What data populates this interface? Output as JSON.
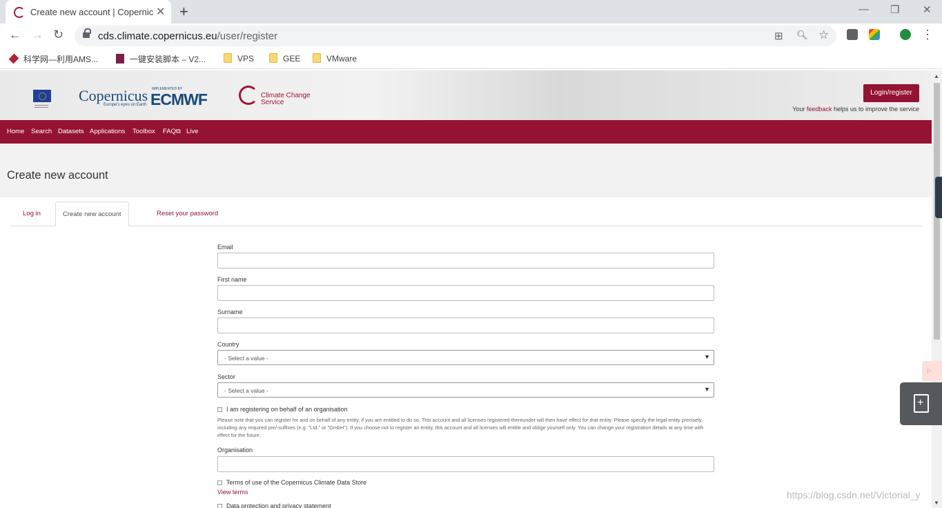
{
  "browser": {
    "tab_title": "Create new account | Copernic",
    "tab_close": "✕",
    "new_tab": "+",
    "url_host": "cds.climate.copernicus.eu",
    "url_path": "/user/register",
    "window_controls": {
      "minimize": "—",
      "restore": "❐",
      "close": "✕"
    },
    "nav": {
      "back": "←",
      "forward": "→",
      "reload": "↻",
      "menu": "⋮"
    },
    "omnibox_icons": {
      "translate": "⊞",
      "zoom": "🔍︎",
      "bookmark": "☆"
    },
    "bookmarks": [
      {
        "label": "科学网—利用AMS...",
        "icon": "site-icon",
        "color": "#b22234"
      },
      {
        "label": "一键安装脚本 – V2...",
        "icon": "site-icon",
        "color": "#7a1f4a"
      },
      {
        "label": "VPS",
        "icon": "folder-icon"
      },
      {
        "label": "GEE",
        "icon": "folder-icon"
      },
      {
        "label": "VMware",
        "icon": "folder-icon"
      }
    ]
  },
  "header": {
    "copernicus_logo": "Copernicus",
    "copernicus_tagline": "Europe's eyes on Earth",
    "ecmwf_small": "IMPLEMENTED BY",
    "ecmwf_logo": "ECMWF",
    "c3s_line1": "Climate Change",
    "c3s_line2": "Service",
    "login_button": "Login/register",
    "feedback_pre": "Your ",
    "feedback_link": "feedback",
    "feedback_post": " helps us to improve the service"
  },
  "nav": {
    "items": [
      "Home",
      "Search",
      "Datasets",
      "Applications",
      "Toolbox",
      "FAQ",
      "Live"
    ],
    "external_icon": "⧉"
  },
  "page": {
    "title": "Create new account",
    "tabs": [
      {
        "label": "Log in",
        "active": false
      },
      {
        "label": "Create new account",
        "active": true
      },
      {
        "label": "Reset your password",
        "active": false
      }
    ]
  },
  "form": {
    "email_label": "Email",
    "first_name_label": "First name",
    "surname_label": "Surname",
    "country_label": "Country",
    "country_value": "- Select a value -",
    "sector_label": "Sector",
    "sector_value": "- Select a value -",
    "select_arrow": "▼",
    "org_checkbox_label": "I am registering on behalf of an organisation",
    "org_help_text": "Please note that you can register for and on behalf of any entity, if you are entitled to do so. This account and all licenses registered thereunder will then have effect for that entity. Please specify the legal entity precisely, including any required pre/-suffixes (e.g. \"Ltd.\" or \"GmbH\"). If you choose not to register an entity, this account and all licenses will entitle and oblige yourself only. You can change your registration details at any time with effect for the future.",
    "organisation_label": "Organisation",
    "terms_label": "Terms of use of the Copernicus Climate Data Store",
    "view_terms": "View terms",
    "privacy_label": "Data protection and privacy statement"
  },
  "overlay": {
    "watermark": "https://blog.csdn.net/Victorial_y",
    "search_glyph": "⌕",
    "doc_glyph": "+"
  }
}
